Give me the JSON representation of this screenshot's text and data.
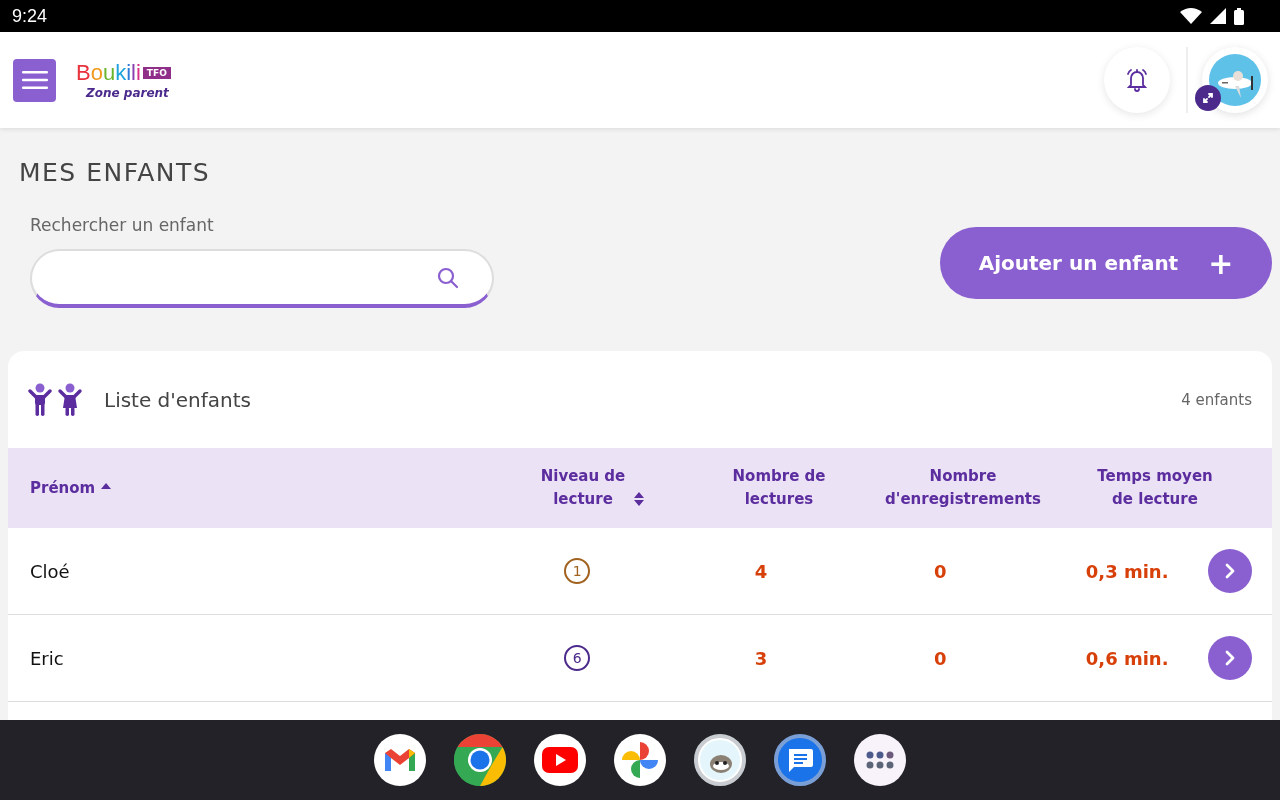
{
  "status_bar": {
    "time": "9:24"
  },
  "header": {
    "logo": "Boukili",
    "logo_badge": "TFO",
    "logo_subtitle": "Zone parent"
  },
  "page": {
    "title": "MES ENFANTS"
  },
  "search": {
    "label": "Rechercher un enfant"
  },
  "add_button": {
    "label": "Ajouter un enfant",
    "icon": "+"
  },
  "list": {
    "title": "Liste d'enfants",
    "count": "4 enfants",
    "columns": [
      {
        "label": "Prénom",
        "sortable": true,
        "sorted": true
      },
      {
        "label": "Niveau de lecture",
        "sortable": true,
        "sorted": false
      },
      {
        "label": "Nombre de lectures"
      },
      {
        "label": "Nombre d'enregistrements"
      },
      {
        "label": "Temps moyen de lecture"
      }
    ],
    "rows": [
      {
        "name": "Cloé",
        "level": "1",
        "color": "#a0621e",
        "readings": "4",
        "recordings": "0",
        "avg_time": "0,3 min."
      },
      {
        "name": "Eric",
        "level": "6",
        "color": "#4b2a8c",
        "readings": "3",
        "recordings": "0",
        "avg_time": "0,6 min."
      }
    ]
  },
  "dock": [
    {
      "kind": "gmail"
    },
    {
      "kind": "chrome"
    },
    {
      "kind": "youtube"
    },
    {
      "kind": "photos"
    },
    {
      "kind": "raccoon"
    },
    {
      "kind": "messages"
    },
    {
      "kind": "apps"
    }
  ]
}
